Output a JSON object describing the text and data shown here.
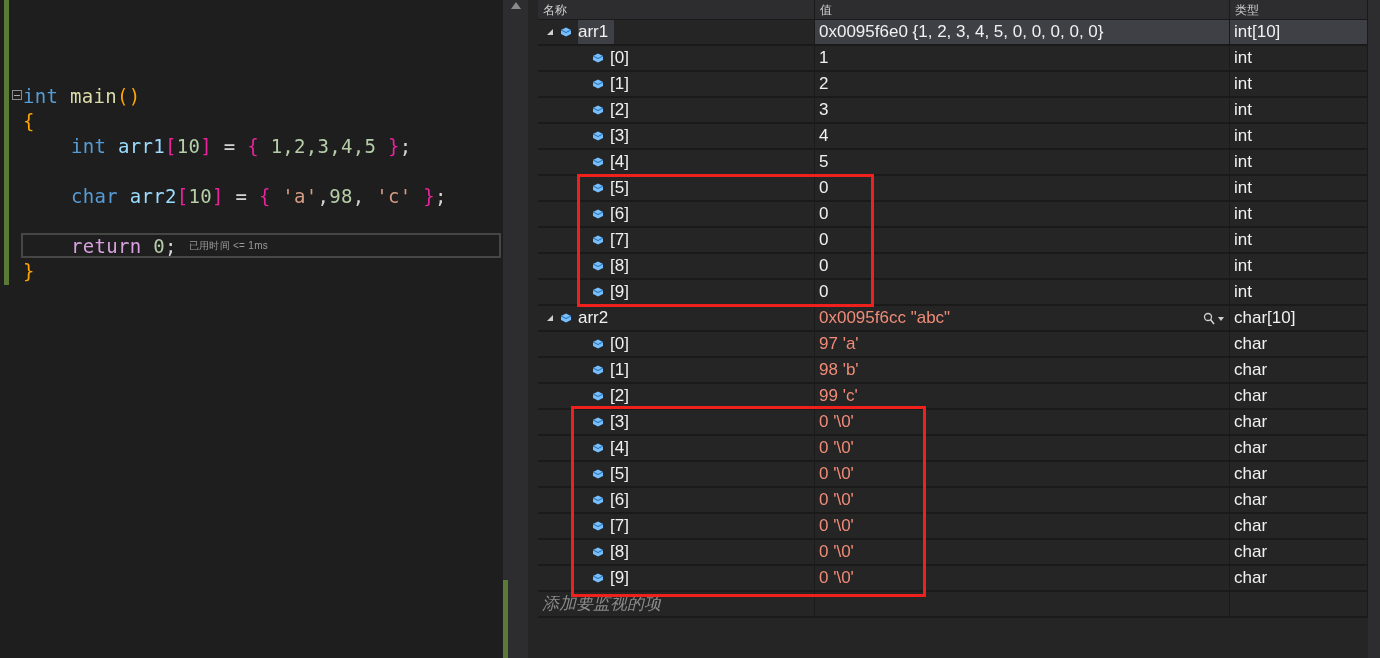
{
  "editor": {
    "lines": [
      {
        "kind": "blank"
      },
      {
        "kind": "blank"
      },
      {
        "kind": "blank"
      },
      {
        "kind": "code",
        "foldable": true,
        "tokens": [
          {
            "kind": "keyword",
            "text": "int "
          },
          {
            "kind": "function",
            "text": "main"
          },
          {
            "kind": "paren",
            "text": "()"
          }
        ]
      },
      {
        "kind": "code",
        "tokens": [
          {
            "kind": "paren",
            "text": "{"
          }
        ]
      },
      {
        "kind": "code",
        "indented": true,
        "tokens": [
          {
            "kind": "keyword",
            "text": "int "
          },
          {
            "kind": "variable",
            "text": "arr1"
          },
          {
            "kind": "bracket",
            "text": "["
          },
          {
            "kind": "number",
            "text": "10"
          },
          {
            "kind": "bracket",
            "text": "]"
          },
          {
            "kind": "punct",
            "text": " = "
          },
          {
            "kind": "bracket",
            "text": "{ "
          },
          {
            "kind": "number",
            "text": "1,2,3,4,5 "
          },
          {
            "kind": "bracket",
            "text": "}"
          },
          {
            "kind": "punct",
            "text": ";"
          }
        ]
      },
      {
        "kind": "blank"
      },
      {
        "kind": "code",
        "indented": true,
        "tokens": [
          {
            "kind": "keyword",
            "text": "char "
          },
          {
            "kind": "variable",
            "text": "arr2"
          },
          {
            "kind": "bracket",
            "text": "["
          },
          {
            "kind": "number",
            "text": "10"
          },
          {
            "kind": "bracket",
            "text": "]"
          },
          {
            "kind": "punct",
            "text": " = "
          },
          {
            "kind": "bracket",
            "text": "{ "
          },
          {
            "kind": "string",
            "text": "'a'"
          },
          {
            "kind": "punct",
            "text": ","
          },
          {
            "kind": "number",
            "text": "98"
          },
          {
            "kind": "punct",
            "text": ", "
          },
          {
            "kind": "string",
            "text": "'c' "
          },
          {
            "kind": "bracket",
            "text": "}"
          },
          {
            "kind": "punct",
            "text": ";"
          }
        ]
      },
      {
        "kind": "blank"
      },
      {
        "kind": "code",
        "indented": true,
        "current": true,
        "hint": "已用时间 <= 1ms",
        "tokens": [
          {
            "kind": "control",
            "text": "return "
          },
          {
            "kind": "number",
            "text": "0"
          },
          {
            "kind": "punct",
            "text": ";"
          }
        ]
      },
      {
        "kind": "code",
        "tokens": [
          {
            "kind": "paren",
            "text": "}"
          }
        ]
      }
    ]
  },
  "watch": {
    "columns": [
      "名称",
      "值",
      "类型"
    ],
    "rows": [
      {
        "name": "arr1",
        "value": "0x0095f6e0 {1, 2, 3, 4, 5, 0, 0, 0, 0, 0}",
        "type": "int[10]",
        "expanded": true,
        "selected": true,
        "changed": false,
        "children": [
          {
            "name": "[0]",
            "value": "1",
            "type": "int",
            "changed": false,
            "boxed": false
          },
          {
            "name": "[1]",
            "value": "2",
            "type": "int",
            "changed": false,
            "boxed": false
          },
          {
            "name": "[2]",
            "value": "3",
            "type": "int",
            "changed": false,
            "boxed": false
          },
          {
            "name": "[3]",
            "value": "4",
            "type": "int",
            "changed": false,
            "boxed": false
          },
          {
            "name": "[4]",
            "value": "5",
            "type": "int",
            "changed": false,
            "boxed": false
          },
          {
            "name": "[5]",
            "value": "0",
            "type": "int",
            "changed": false,
            "boxed": true
          },
          {
            "name": "[6]",
            "value": "0",
            "type": "int",
            "changed": false,
            "boxed": true
          },
          {
            "name": "[7]",
            "value": "0",
            "type": "int",
            "changed": false,
            "boxed": true
          },
          {
            "name": "[8]",
            "value": "0",
            "type": "int",
            "changed": false,
            "boxed": true
          },
          {
            "name": "[9]",
            "value": "0",
            "type": "int",
            "changed": false,
            "boxed": true
          }
        ]
      },
      {
        "name": "arr2",
        "value": "0x0095f6cc \"abc\"",
        "type": "char[10]",
        "expanded": true,
        "selected": false,
        "changed": true,
        "inspector": true,
        "children": [
          {
            "name": "[0]",
            "value": "97 'a'",
            "type": "char",
            "changed": true,
            "boxed": false
          },
          {
            "name": "[1]",
            "value": "98 'b'",
            "type": "char",
            "changed": true,
            "boxed": false
          },
          {
            "name": "[2]",
            "value": "99 'c'",
            "type": "char",
            "changed": true,
            "boxed": false
          },
          {
            "name": "[3]",
            "value": "0 '\\0'",
            "type": "char",
            "changed": true,
            "boxed": true
          },
          {
            "name": "[4]",
            "value": "0 '\\0'",
            "type": "char",
            "changed": true,
            "boxed": true
          },
          {
            "name": "[5]",
            "value": "0 '\\0'",
            "type": "char",
            "changed": true,
            "boxed": true
          },
          {
            "name": "[6]",
            "value": "0 '\\0'",
            "type": "char",
            "changed": true,
            "boxed": true
          },
          {
            "name": "[7]",
            "value": "0 '\\0'",
            "type": "char",
            "changed": true,
            "boxed": true
          },
          {
            "name": "[8]",
            "value": "0 '\\0'",
            "type": "char",
            "changed": true,
            "boxed": true
          },
          {
            "name": "[9]",
            "value": "0 '\\0'",
            "type": "char",
            "changed": true,
            "boxed": true
          }
        ]
      }
    ],
    "add_item": {
      "placeholder": "添加要监视的项"
    }
  }
}
